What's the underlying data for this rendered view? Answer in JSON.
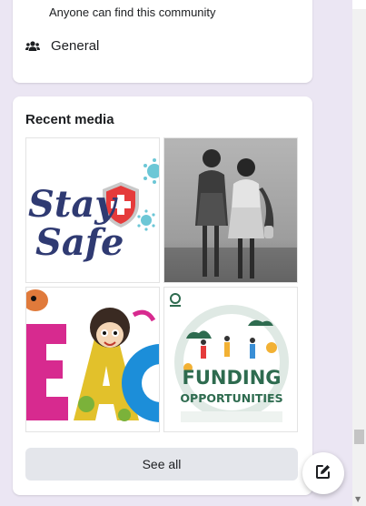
{
  "about": {
    "visibility_text": "Anyone can find this community",
    "category_icon": "group-icon",
    "category_label": "General"
  },
  "recent_media": {
    "title": "Recent media",
    "see_all_label": "See all",
    "items": [
      {
        "name": "stay-safe-image",
        "caption_line1": "Stay",
        "caption_line2": "Safe"
      },
      {
        "name": "two-children-photo"
      },
      {
        "name": "colorful-letters-image",
        "letters": "EAC"
      },
      {
        "name": "funding-opportunities-image",
        "caption_line1": "FUNDING",
        "caption_line2": "OPPORTUNITIES"
      }
    ]
  },
  "compose_icon": "edit-icon",
  "colors": {
    "background": "#ebe6f3",
    "card": "#ffffff",
    "button": "#e4e6eb",
    "stay_safe_text": "#2f3a72",
    "shield_red": "#e53b3b",
    "virus_teal": "#6cc7d6",
    "funding_green": "#2e6b4f"
  }
}
